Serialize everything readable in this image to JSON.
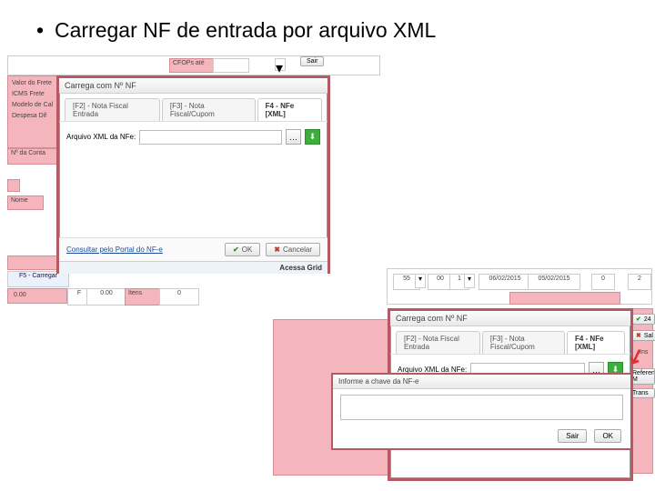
{
  "bullet": "Carregar NF de entrada por arquivo XML",
  "bg_left": {
    "l1": "Valor do Frete",
    "l2": "ICMS Frete",
    "l3": "Modelo de Cal",
    "l4": "Despesa Dif",
    "l5": "Nº da Conta",
    "l6": "Nome",
    "f5": "F5 - Carregar",
    "v1": "0.00",
    "v2": "F",
    "v3": "0.00",
    "itens": "Itens",
    "zero": "0",
    "top1": "CFOPs até"
  },
  "dlg1": {
    "title": "Carrega com Nº NF",
    "tab1": "[F2] - Nota Fiscal Entrada",
    "tab2": "[F3] - Nota Fiscal/Cupom",
    "tab3": "F4 - NFe [XML]",
    "label": "Arquivo XML da NFe:",
    "portal": "Consultar pelo Portal do NF-e",
    "ok": "OK",
    "cancel": "Cancelar",
    "status": "Acessa Grid"
  },
  "midbar": {
    "c1": "55",
    "c2": "00",
    "c3": "1",
    "d1": "06/02/2015",
    "d2": "05/02/2015",
    "z": "0",
    "q": "2"
  },
  "right_strip": {
    "b1": "24",
    "b2": "Sal",
    "ins": "Ins",
    "b3": "Referencia M",
    "b4": "Trans"
  },
  "dlg2": {
    "title": "Carrega com Nº NF",
    "tab1": "[F2] - Nota Fiscal Entrada",
    "tab2": "[F3] - Nota Fiscal/Cupom",
    "tab3": "F4 - NFe [XML]",
    "label": "Arquivo XML da NFe:",
    "prompt_title": "Informe a chave da NF-e",
    "sair": "Sair",
    "ok": "OK"
  }
}
